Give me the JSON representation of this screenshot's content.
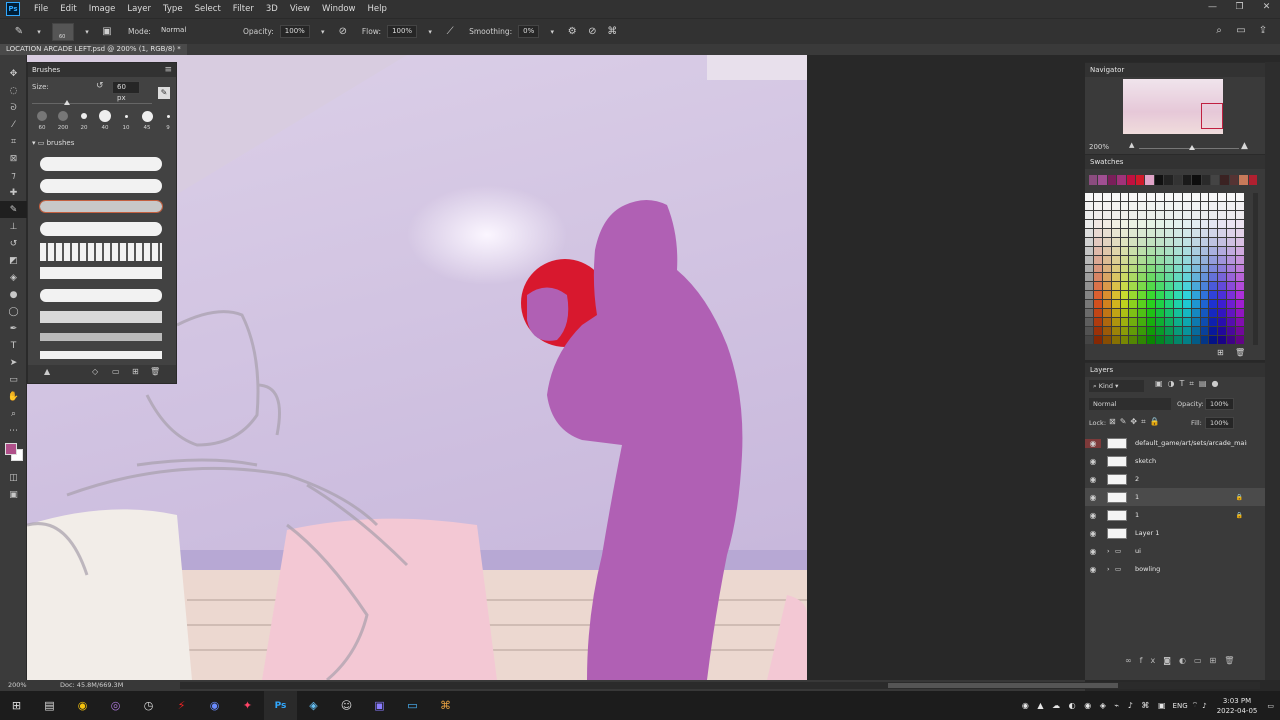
{
  "app": {
    "logo_text": "Ps",
    "menu": [
      "File",
      "Edit",
      "Image",
      "Layer",
      "Type",
      "Select",
      "Filter",
      "3D",
      "View",
      "Window",
      "Help"
    ],
    "window_controls": [
      "—",
      "❐",
      "✕"
    ]
  },
  "options": {
    "brush_size": "60",
    "mode_label": "Mode:",
    "mode_value": "Normal",
    "opacity_label": "Opacity:",
    "opacity_value": "100%",
    "flow_label": "Flow:",
    "flow_value": "100%",
    "smoothing_label": "Smoothing:",
    "smoothing_value": "0%"
  },
  "document": {
    "tab_title": "LOCATION ARCADE LEFT.psd @ 200% (1, RGB/8) *"
  },
  "brushes_panel": {
    "title": "Brushes",
    "size_label": "Size:",
    "size_value": "60 px",
    "presets": [
      "60",
      "200",
      "20",
      "40",
      "10",
      "45",
      "9"
    ],
    "folder": "brushes"
  },
  "navigator": {
    "title": "Navigator",
    "zoom": "200%"
  },
  "swatches": {
    "title": "Swatches",
    "top_row": [
      "#8a4c7e",
      "#a04f92",
      "#7a1f5a",
      "#a0327a",
      "#c01040",
      "#d01a2a",
      "#e0a4c8",
      "#111111",
      "#222222",
      "#333333",
      "#1a1a1a",
      "#0d0d0d",
      "#2a2a2a",
      "#444444",
      "#3a2222",
      "#553333",
      "#c87a5a",
      "#b02030"
    ]
  },
  "layers": {
    "title": "Layers",
    "filter_label": "Kind",
    "blend_mode": "Normal",
    "opacity_label": "Opacity:",
    "opacity_value": "100%",
    "lock_label": "Lock:",
    "fill_label": "Fill:",
    "fill_value": "100%",
    "items": [
      {
        "name": "default_game/art/sets/arcade_main/",
        "kind": "layer",
        "locked": false
      },
      {
        "name": "sketch",
        "kind": "layer",
        "locked": false
      },
      {
        "name": "2",
        "kind": "layer",
        "locked": false
      },
      {
        "name": "1",
        "kind": "layer",
        "locked": true,
        "selected": true
      },
      {
        "name": "1",
        "kind": "layer",
        "locked": true
      },
      {
        "name": "Layer 1",
        "kind": "layer",
        "locked": false
      },
      {
        "name": "ui",
        "kind": "group",
        "locked": false
      },
      {
        "name": "bowling",
        "kind": "group",
        "locked": false
      }
    ]
  },
  "status": {
    "zoom": "200%",
    "doc": "Doc: 45.8M/669.3M"
  },
  "taskbar": {
    "lang": "ENG",
    "time": "3:03 PM",
    "date": "2022-04-05"
  },
  "colors": {
    "foreground": "#b0508a",
    "background": "#ffffff"
  }
}
